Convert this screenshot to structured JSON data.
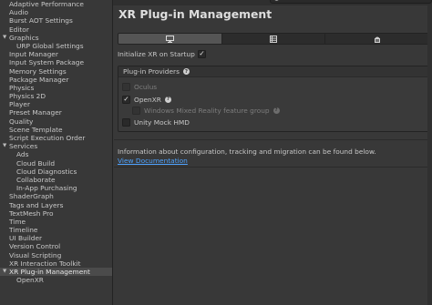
{
  "sidebar": {
    "items": [
      {
        "label": "Adaptive Performance",
        "level": 0
      },
      {
        "label": "Audio",
        "level": 0
      },
      {
        "label": "Burst AOT Settings",
        "level": 0
      },
      {
        "label": "Editor",
        "level": 0
      },
      {
        "label": "Graphics",
        "level": 0,
        "expanded": true
      },
      {
        "label": "URP Global Settings",
        "level": 1
      },
      {
        "label": "Input Manager",
        "level": 0
      },
      {
        "label": "Input System Package",
        "level": 0
      },
      {
        "label": "Memory Settings",
        "level": 0
      },
      {
        "label": "Package Manager",
        "level": 0
      },
      {
        "label": "Physics",
        "level": 0
      },
      {
        "label": "Physics 2D",
        "level": 0
      },
      {
        "label": "Player",
        "level": 0
      },
      {
        "label": "Preset Manager",
        "level": 0
      },
      {
        "label": "Quality",
        "level": 0
      },
      {
        "label": "Scene Template",
        "level": 0
      },
      {
        "label": "Script Execution Order",
        "level": 0
      },
      {
        "label": "Services",
        "level": 0,
        "expanded": true
      },
      {
        "label": "Ads",
        "level": 1
      },
      {
        "label": "Cloud Build",
        "level": 1
      },
      {
        "label": "Cloud Diagnostics",
        "level": 1
      },
      {
        "label": "Collaborate",
        "level": 1
      },
      {
        "label": "In-App Purchasing",
        "level": 1
      },
      {
        "label": "ShaderGraph",
        "level": 0
      },
      {
        "label": "Tags and Layers",
        "level": 0
      },
      {
        "label": "TextMesh Pro",
        "level": 0
      },
      {
        "label": "Time",
        "level": 0
      },
      {
        "label": "Timeline",
        "level": 0
      },
      {
        "label": "UI Builder",
        "level": 0
      },
      {
        "label": "Version Control",
        "level": 0
      },
      {
        "label": "Visual Scripting",
        "level": 0
      },
      {
        "label": "XR Interaction Toolkit",
        "level": 0
      },
      {
        "label": "XR Plug-in Management",
        "level": 0,
        "expanded": true,
        "selected": true
      },
      {
        "label": "OpenXR",
        "level": 1
      }
    ]
  },
  "main": {
    "title": "XR Plug-in Management",
    "tabs": [
      {
        "icon": "desktop-icon",
        "active": true
      },
      {
        "icon": "server-icon",
        "active": false
      },
      {
        "icon": "android-icon",
        "active": false
      }
    ],
    "init_label": "Initialize XR on Startup",
    "init_checked": true,
    "providers_header": "Plug-in Providers",
    "providers": [
      {
        "label": "Oculus",
        "checked": false,
        "disabled": true,
        "help": false,
        "sub": false
      },
      {
        "label": "OpenXR",
        "checked": true,
        "disabled": false,
        "help": true,
        "sub": false
      },
      {
        "label": "Windows Mixed Reality feature group",
        "checked": false,
        "disabled": true,
        "help": true,
        "sub": true
      },
      {
        "label": "Unity Mock HMD",
        "checked": false,
        "disabled": false,
        "help": false,
        "sub": false
      }
    ],
    "info_text": "Information about configuration, tracking and migration can be found below.",
    "doc_link": "View Documentation"
  },
  "colors": {
    "link": "#4ea3ff",
    "selected_bg": "#4b4b4b",
    "background": "#383838"
  }
}
